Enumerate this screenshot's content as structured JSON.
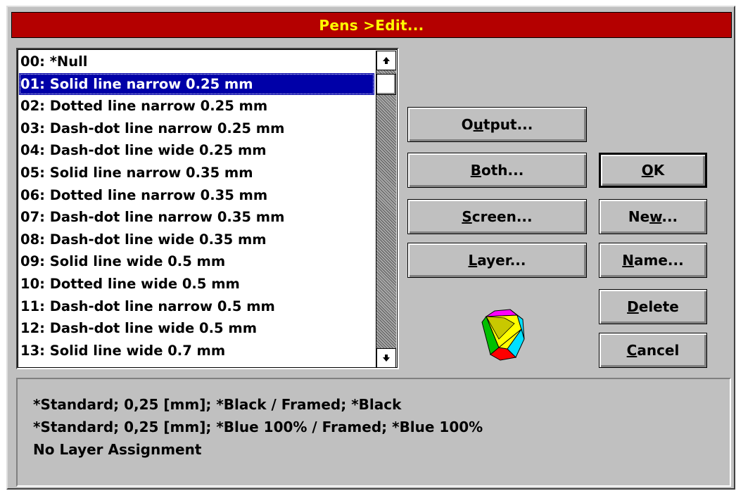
{
  "window": {
    "title": "Pens >Edit..."
  },
  "pen_list": {
    "selected_index": 1,
    "items": [
      "00: *Null",
      "01: Solid line narrow 0.25 mm",
      "02: Dotted line narrow 0.25 mm",
      "03: Dash-dot line narrow 0.25 mm",
      "04: Dash-dot line wide 0.25 mm",
      "05: Solid line narrow 0.35 mm",
      "06: Dotted line narrow 0.35 mm",
      "07: Dash-dot line narrow 0.35 mm",
      "08: Dash-dot line wide 0.35 mm",
      "09: Solid line wide 0.5 mm",
      "10: Dotted line wide 0.5 mm",
      "11: Dash-dot line narrow 0.5 mm",
      "12: Dash-dot line wide 0.5 mm",
      "13: Solid line wide 0.7 mm"
    ],
    "scroll_up_icon": "up-arrow",
    "scroll_down_icon": "down-arrow"
  },
  "buttons": {
    "output": {
      "pre": "O",
      "mn": "u",
      "post": "tput..."
    },
    "both": {
      "pre": "",
      "mn": "B",
      "post": "oth..."
    },
    "screen": {
      "pre": "",
      "mn": "S",
      "post": "creen..."
    },
    "layer": {
      "pre": "",
      "mn": "L",
      "post": "ayer..."
    },
    "ok": {
      "pre": "",
      "mn": "O",
      "post": "K"
    },
    "new": {
      "pre": "Ne",
      "mn": "w",
      "post": "..."
    },
    "name": {
      "pre": "",
      "mn": "N",
      "post": "ame..."
    },
    "delete": {
      "pre": "",
      "mn": "D",
      "post": "elete"
    },
    "cancel": {
      "pre": "",
      "mn": "C",
      "post": "ancel"
    }
  },
  "info": {
    "line1": "*Standard; 0,25 [mm]; *Black / Framed; *Black",
    "line2": "*Standard; 0,25 [mm]; *Blue 100% / Framed; *Blue 100%",
    "line3": "No Layer Assignment"
  },
  "icon": "pen-cube-icon",
  "colors": {
    "titlebar": "#b40000",
    "title_text": "#ffff00",
    "selection": "#0000a8",
    "face": "#c0c0c0"
  }
}
